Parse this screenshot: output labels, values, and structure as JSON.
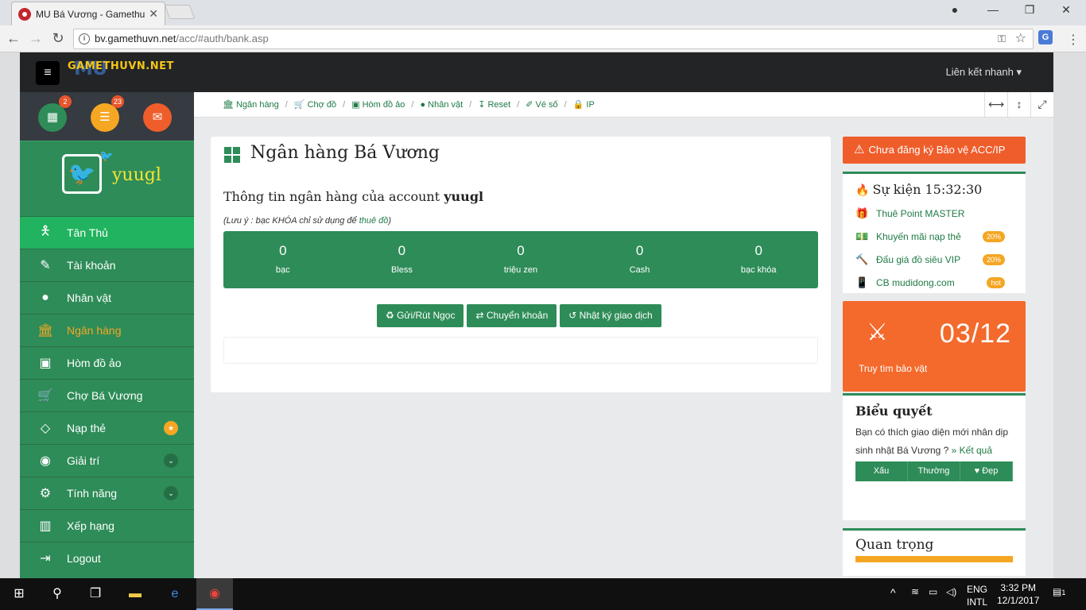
{
  "browser": {
    "tab_title": "MU Bá Vương - Gamethu",
    "url_host": "bv.gamethuvn.net",
    "url_path": "/acc/#auth/bank.asp"
  },
  "topnav": {
    "logo_text": "GAMETHUVN.NET",
    "logo_mu": "MU",
    "quick_links": "Liên kết nhanh ▾"
  },
  "sidebar": {
    "badges": {
      "calendar": "2",
      "list": "23"
    },
    "username": "yuugl",
    "items": [
      {
        "label": "Tân Thủ",
        "icon": "person-icon"
      },
      {
        "label": "Tài khoản",
        "icon": "edit-icon"
      },
      {
        "label": "Nhân vật",
        "icon": "user-icon"
      },
      {
        "label": "Ngân hàng",
        "icon": "bank-icon"
      },
      {
        "label": "Hòm đồ ảo",
        "icon": "briefcase-icon"
      },
      {
        "label": "Chợ Bá Vương",
        "icon": "cart-icon"
      },
      {
        "label": "Nạp thẻ",
        "icon": "diamond-icon"
      },
      {
        "label": "Giải trí",
        "icon": "android-icon"
      },
      {
        "label": "Tính năng",
        "icon": "gears-icon"
      },
      {
        "label": "Xếp hạng",
        "icon": "bar-chart-icon"
      },
      {
        "label": "Logout",
        "icon": "logout-icon"
      }
    ]
  },
  "breadcrumbs": [
    "Ngân hàng",
    "Chợ đồ",
    "Hòm đồ ảo",
    "Nhân vật",
    "Reset",
    "Vé số",
    "IP"
  ],
  "main": {
    "title": "Ngân hàng Bá Vương",
    "subtitle_prefix": "Thông tin ngân hàng của account",
    "subtitle_user": "yuugl",
    "note_prefix": "(Lưu ý : bạc KHÓA chỉ sử dụng để",
    "note_link": "thuê đồ",
    "note_suffix": ")",
    "stats": [
      {
        "value": "0",
        "label": "bạc"
      },
      {
        "value": "0",
        "label": "Bless"
      },
      {
        "value": "0",
        "label": "triệu zen"
      },
      {
        "value": "0",
        "label": "Cash"
      },
      {
        "value": "0",
        "label": "bạc khóa"
      }
    ],
    "buttons": [
      "Gửi/Rút Ngọc",
      "Chuyển khoản",
      "Nhật ký giao dịch"
    ]
  },
  "right": {
    "warning": "Chưa đăng ký Bảo vệ ACC/IP",
    "events_title": "Sự kiện 15:32:30",
    "events": [
      {
        "label": "Thuê Point MASTER",
        "tag": ""
      },
      {
        "label": "Khuyến mãi nạp thẻ",
        "tag": "20%"
      },
      {
        "label": "Đấu giá đồ siêu VIP",
        "tag": "20%"
      },
      {
        "label": "CB mudidong.com",
        "tag": "hot"
      }
    ],
    "treasure_date": "03/12",
    "treasure_label": "Truy tìm bảo vật",
    "vote_title": "Biểu quyết",
    "vote_question": "Bạn có thích giao diện mới nhân dịp sinh nhật Bá Vương ?",
    "vote_result": "» Kết quả",
    "vote_options": [
      "Xấu",
      "Thường",
      "♥ Đẹp"
    ],
    "important_title": "Quan trọng"
  },
  "taskbar": {
    "lang1": "ENG",
    "lang2": "INTL",
    "time": "3:32 PM",
    "date": "12/1/2017",
    "notif_count": "1"
  }
}
